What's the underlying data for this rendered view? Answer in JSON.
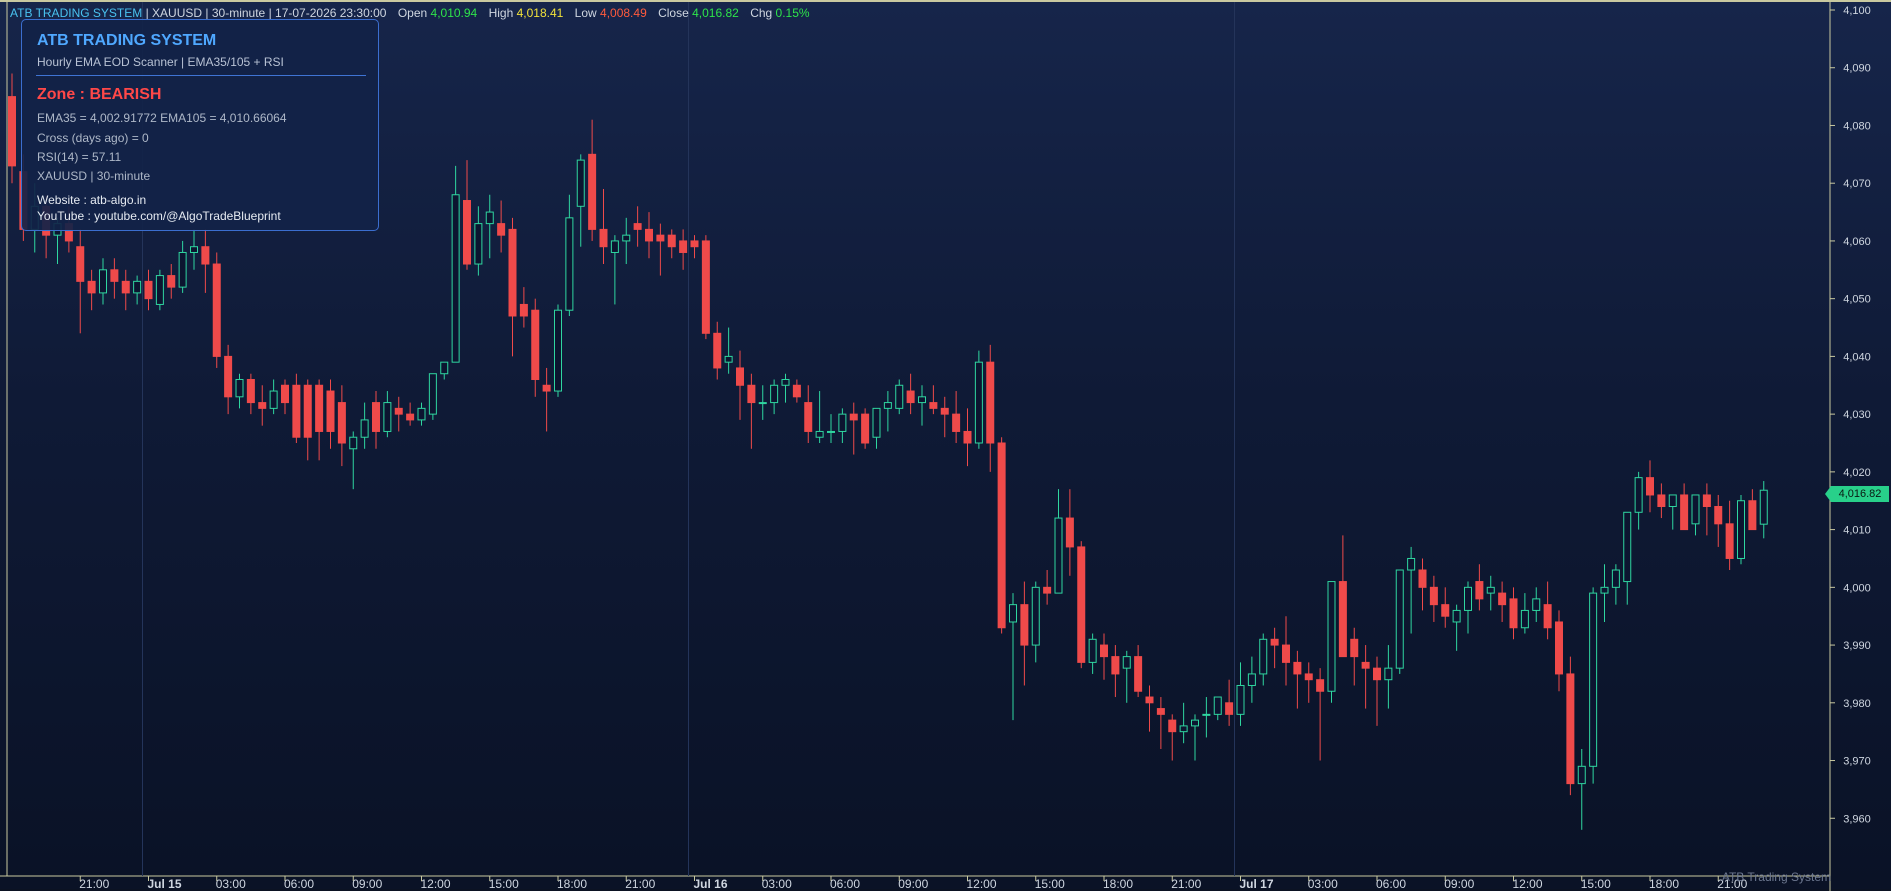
{
  "header": {
    "system": "ATB TRADING SYSTEM",
    "symbol": "XAUUSD",
    "timeframe": "30-minute",
    "datetime": "17-07-2026 23:30:00",
    "open_label": "Open",
    "open_value": "4,010.94",
    "high_label": "High",
    "high_value": "4,018.41",
    "low_label": "Low",
    "low_value": "4,008.49",
    "close_label": "Close",
    "close_value": "4,016.82",
    "chg_label": "Chg",
    "chg_value": "0.15%"
  },
  "infobox": {
    "title": "ATB TRADING SYSTEM",
    "subtitle": "Hourly EMA EOD Scanner  |  EMA35/105 + RSI",
    "zone": "Zone : BEARISH",
    "ema_line": "EMA35  =  4,002.91772     EMA105  =  4,010.66064",
    "cross_line": "Cross (days ago)  =  0",
    "rsi_line": "RSI(14)  =  57.11",
    "symbol_line": "XAUUSD   |   30-minute",
    "website": "Website : atb-algo.in",
    "youtube": "YouTube : youtube.com/@AlgoTradeBlueprint"
  },
  "watermark": "ATB Trading System",
  "last_price_tag": "4,016.82",
  "colors": {
    "up": "#2fd6a0",
    "down": "#ef4a4a",
    "axis_text": "#cfd6e0",
    "grid": "#1c2a4a"
  },
  "chart_data": {
    "type": "candlestick",
    "ylim": [
      3950,
      4100
    ],
    "y_ticks": [
      "3,960",
      "3,970",
      "3,980",
      "3,990",
      "4,000",
      "4,010",
      "4,020",
      "4,030",
      "4,040",
      "4,050",
      "4,060",
      "4,070",
      "4,080",
      "4,090",
      "4,100"
    ],
    "x_ticks": [
      {
        "label": "21:00",
        "i": 6
      },
      {
        "label": "Jul 15",
        "i": 12,
        "bold": true
      },
      {
        "label": "03:00",
        "i": 18
      },
      {
        "label": "06:00",
        "i": 24
      },
      {
        "label": "09:00",
        "i": 30
      },
      {
        "label": "12:00",
        "i": 36
      },
      {
        "label": "15:00",
        "i": 42
      },
      {
        "label": "18:00",
        "i": 48
      },
      {
        "label": "21:00",
        "i": 54
      },
      {
        "label": "Jul 16",
        "i": 60,
        "bold": true
      },
      {
        "label": "03:00",
        "i": 66
      },
      {
        "label": "06:00",
        "i": 72
      },
      {
        "label": "09:00",
        "i": 78
      },
      {
        "label": "12:00",
        "i": 84
      },
      {
        "label": "15:00",
        "i": 90
      },
      {
        "label": "18:00",
        "i": 96
      },
      {
        "label": "21:00",
        "i": 102
      },
      {
        "label": "Jul 17",
        "i": 108,
        "bold": true
      },
      {
        "label": "03:00",
        "i": 114
      },
      {
        "label": "06:00",
        "i": 120
      },
      {
        "label": "09:00",
        "i": 126
      },
      {
        "label": "12:00",
        "i": 132
      },
      {
        "label": "15:00",
        "i": 138
      },
      {
        "label": "18:00",
        "i": 144
      },
      {
        "label": "21:00",
        "i": 150
      }
    ],
    "candles": [
      [
        4085,
        4089,
        4070,
        4073
      ],
      [
        4072,
        4075,
        4060,
        4062
      ],
      [
        4062,
        4070,
        4058,
        4066
      ],
      [
        4066,
        4068,
        4057,
        4061
      ],
      [
        4061,
        4064,
        4056,
        4063
      ],
      [
        4063,
        4066,
        4058,
        4060
      ],
      [
        4059,
        4062,
        4044,
        4053
      ],
      [
        4053,
        4055,
        4048,
        4051
      ],
      [
        4051,
        4057,
        4049,
        4055
      ],
      [
        4055,
        4057,
        4050,
        4053
      ],
      [
        4053,
        4055,
        4048,
        4051
      ],
      [
        4051,
        4054,
        4049,
        4053
      ],
      [
        4053,
        4055,
        4048,
        4050
      ],
      [
        4049,
        4055,
        4048,
        4054
      ],
      [
        4054,
        4056,
        4050,
        4052
      ],
      [
        4052,
        4060,
        4051,
        4058
      ],
      [
        4058,
        4062,
        4055,
        4059
      ],
      [
        4059,
        4062,
        4051,
        4056
      ],
      [
        4056,
        4058,
        4038,
        4040
      ],
      [
        4040,
        4042,
        4030,
        4033
      ],
      [
        4033,
        4037,
        4031,
        4036
      ],
      [
        4036,
        4037,
        4030,
        4032
      ],
      [
        4032,
        4035,
        4028,
        4031
      ],
      [
        4031,
        4036,
        4030,
        4034
      ],
      [
        4035,
        4036,
        4030,
        4032
      ],
      [
        4035,
        4037,
        4025,
        4026
      ],
      [
        4035,
        4036,
        4022,
        4026
      ],
      [
        4035,
        4036,
        4022,
        4027
      ],
      [
        4034,
        4036,
        4024,
        4027
      ],
      [
        4032,
        4035,
        4021,
        4025
      ],
      [
        4024,
        4027,
        4017,
        4026
      ],
      [
        4026,
        4032,
        4024,
        4029
      ],
      [
        4032,
        4034,
        4024,
        4027
      ],
      [
        4027,
        4034,
        4026,
        4032
      ],
      [
        4031,
        4033,
        4027,
        4030
      ],
      [
        4030,
        4032,
        4028,
        4029
      ],
      [
        4029,
        4032,
        4028,
        4031
      ],
      [
        4030,
        4036,
        4029,
        4037
      ],
      [
        4037,
        4039,
        4036,
        4039
      ],
      [
        4039,
        4073,
        4039,
        4068
      ],
      [
        4067,
        4074,
        4055,
        4056
      ],
      [
        4056,
        4066,
        4054,
        4063
      ],
      [
        4063,
        4068,
        4057,
        4065
      ],
      [
        4063,
        4067,
        4058,
        4061
      ],
      [
        4062,
        4064,
        4040,
        4047
      ],
      [
        4049,
        4052,
        4045,
        4047
      ],
      [
        4048,
        4050,
        4033,
        4036
      ],
      [
        4035,
        4038,
        4027,
        4034
      ],
      [
        4034,
        4049,
        4033,
        4048
      ],
      [
        4048,
        4068,
        4047,
        4064
      ],
      [
        4066,
        4075,
        4059,
        4074
      ],
      [
        4075,
        4081,
        4060,
        4062
      ],
      [
        4062,
        4069,
        4056,
        4059
      ],
      [
        4058,
        4061,
        4049,
        4060
      ],
      [
        4060,
        4064,
        4056,
        4061
      ],
      [
        4063,
        4066,
        4059,
        4062
      ],
      [
        4062,
        4065,
        4057,
        4060
      ],
      [
        4061,
        4063,
        4054,
        4060
      ],
      [
        4061,
        4062,
        4057,
        4059
      ],
      [
        4060,
        4062,
        4055,
        4058
      ],
      [
        4060,
        4061,
        4057,
        4059
      ],
      [
        4060,
        4061,
        4043,
        4044
      ],
      [
        4044,
        4046,
        4036,
        4038
      ],
      [
        4039,
        4045,
        4037,
        4040
      ],
      [
        4038,
        4041,
        4029,
        4035
      ],
      [
        4035,
        4037,
        4024,
        4032
      ],
      [
        4032,
        4035,
        4029,
        4032
      ],
      [
        4032,
        4036,
        4030,
        4035
      ],
      [
        4035,
        4037,
        4032,
        4036
      ],
      [
        4035,
        4036,
        4032,
        4033
      ],
      [
        4032,
        4035,
        4025,
        4027
      ],
      [
        4026,
        4034,
        4025,
        4027
      ],
      [
        4027,
        4030,
        4025,
        4027
      ],
      [
        4027,
        4031,
        4025,
        4030
      ],
      [
        4030,
        4032,
        4023,
        4029
      ],
      [
        4030,
        4031,
        4024,
        4025
      ],
      [
        4026,
        4031,
        4024,
        4031
      ],
      [
        4031,
        4034,
        4027,
        4032
      ],
      [
        4031,
        4036,
        4030,
        4035
      ],
      [
        4034,
        4037,
        4030,
        4032
      ],
      [
        4032,
        4035,
        4028,
        4033
      ],
      [
        4032,
        4035,
        4030,
        4031
      ],
      [
        4031,
        4033,
        4026,
        4030
      ],
      [
        4030,
        4034,
        4025,
        4027
      ],
      [
        4027,
        4031,
        4021,
        4025
      ],
      [
        4025,
        4041,
        4024,
        4039
      ],
      [
        4039,
        4042,
        4020,
        4025
      ],
      [
        4025,
        4026,
        3992,
        3993
      ],
      [
        3994,
        3999,
        3977,
        3997
      ],
      [
        3997,
        4001,
        3983,
        3990
      ],
      [
        3990,
        4001,
        3987,
        4000
      ],
      [
        4000,
        4003,
        3997,
        3999
      ],
      [
        3999,
        4017,
        3999,
        4012
      ],
      [
        4012,
        4017,
        4002,
        4007
      ],
      [
        4007,
        4008,
        3986,
        3987
      ],
      [
        3987,
        3992,
        3985,
        3991
      ],
      [
        3990,
        3992,
        3984,
        3988
      ],
      [
        3988,
        3990,
        3981,
        3985
      ],
      [
        3986,
        3989,
        3980,
        3988
      ],
      [
        3988,
        3990,
        3981,
        3982
      ],
      [
        3981,
        3983,
        3975,
        3980
      ],
      [
        3979,
        3981,
        3972,
        3978
      ],
      [
        3977,
        3978,
        3970,
        3975
      ],
      [
        3975,
        3980,
        3973,
        3976
      ],
      [
        3976,
        3978,
        3970,
        3977
      ],
      [
        3978,
        3981,
        3974,
        3978
      ],
      [
        3978,
        3981,
        3977,
        3981
      ],
      [
        3980,
        3984,
        3976,
        3978
      ],
      [
        3978,
        3987,
        3976,
        3983
      ],
      [
        3983,
        3988,
        3980,
        3985
      ],
      [
        3985,
        3992,
        3983,
        3991
      ],
      [
        3991,
        3993,
        3986,
        3990
      ],
      [
        3990,
        3995,
        3983,
        3987
      ],
      [
        3987,
        3989,
        3979,
        3985
      ],
      [
        3985,
        3987,
        3980,
        3984
      ],
      [
        3984,
        3986,
        3970,
        3982
      ],
      [
        3982,
        3993,
        3980,
        4001
      ],
      [
        4001,
        4009,
        3989,
        3988
      ],
      [
        3991,
        3993,
        3983,
        3988
      ],
      [
        3987,
        3990,
        3979,
        3986
      ],
      [
        3986,
        3988,
        3976,
        3984
      ],
      [
        3984,
        3990,
        3979,
        3986
      ],
      [
        3986,
        4003,
        3985,
        4003
      ],
      [
        4003,
        4007,
        3992,
        4005
      ],
      [
        4003,
        4005,
        3996,
        4000
      ],
      [
        4000,
        4002,
        3994,
        3997
      ],
      [
        3997,
        4000,
        3993,
        3995
      ],
      [
        3994,
        3997,
        3989,
        3996
      ],
      [
        3996,
        4001,
        3992,
        4000
      ],
      [
        4001,
        4004,
        3996,
        3998
      ],
      [
        3999,
        4002,
        3996,
        4000
      ],
      [
        3999,
        4001,
        3994,
        3997
      ],
      [
        3998,
        4000,
        3991,
        3993
      ],
      [
        3993,
        3999,
        3992,
        3996
      ],
      [
        3996,
        4000,
        3994,
        3998
      ],
      [
        3997,
        4001,
        3991,
        3993
      ],
      [
        3994,
        3996,
        3982,
        3985
      ],
      [
        3985,
        3988,
        3964,
        3966
      ],
      [
        3966,
        3972,
        3958,
        3969
      ],
      [
        3969,
        4000,
        3966,
        3999
      ],
      [
        3999,
        4004,
        3994,
        4000
      ],
      [
        4000,
        4004,
        3997,
        4003
      ],
      [
        4001,
        4009,
        3997,
        4013
      ],
      [
        4013,
        4020,
        4010,
        4019
      ],
      [
        4019,
        4022,
        4013,
        4016
      ],
      [
        4016,
        4018,
        4012,
        4014
      ],
      [
        4014,
        4016,
        4010,
        4016
      ],
      [
        4016,
        4018,
        4011,
        4010
      ],
      [
        4011,
        4014,
        4009,
        4016
      ],
      [
        4016,
        4018,
        4009,
        4014
      ],
      [
        4014,
        4016,
        4007,
        4011
      ],
      [
        4011,
        4015,
        4003,
        4005
      ],
      [
        4005,
        4016,
        4004,
        4015
      ],
      [
        4015,
        4017,
        4010,
        4010
      ],
      [
        4010.94,
        4018.41,
        4008.49,
        4016.82
      ]
    ]
  }
}
